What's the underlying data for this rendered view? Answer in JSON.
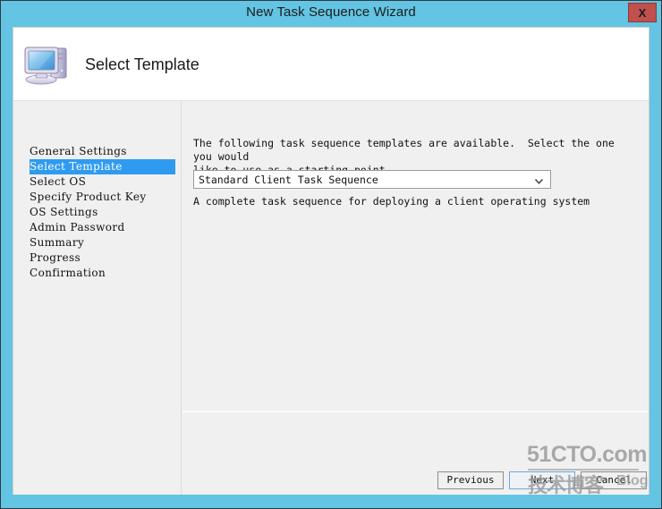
{
  "window": {
    "title": "New Task Sequence Wizard",
    "close_label": "X",
    "titlebar_color": "#63c4e3",
    "close_color": "#c0504d"
  },
  "header": {
    "page_title": "Select Template",
    "icon": "computer-monitor-icon"
  },
  "sidebar": {
    "selected_index": 1,
    "highlight_color": "#2f9bf0",
    "items": [
      {
        "label": "General Settings"
      },
      {
        "label": "Select Template"
      },
      {
        "label": "Select OS"
      },
      {
        "label": "Specify Product Key"
      },
      {
        "label": "OS Settings"
      },
      {
        "label": "Admin Password"
      },
      {
        "label": "Summary"
      },
      {
        "label": "Progress"
      },
      {
        "label": "Confirmation"
      }
    ]
  },
  "content": {
    "intro_text": "The following task sequence templates are available.  Select the one you would\nlike to use as a starting point.",
    "template_select": {
      "value": "Standard Client Task Sequence",
      "icon": "chevron-down-icon"
    },
    "template_description": "A complete task sequence for deploying a client operating system"
  },
  "footer": {
    "previous_label": "Previous",
    "next_label": "Next",
    "cancel_label": "Cancel"
  },
  "watermark": {
    "main": "51CTO.com",
    "chinese": "技术博客",
    "blog": "Blog"
  }
}
